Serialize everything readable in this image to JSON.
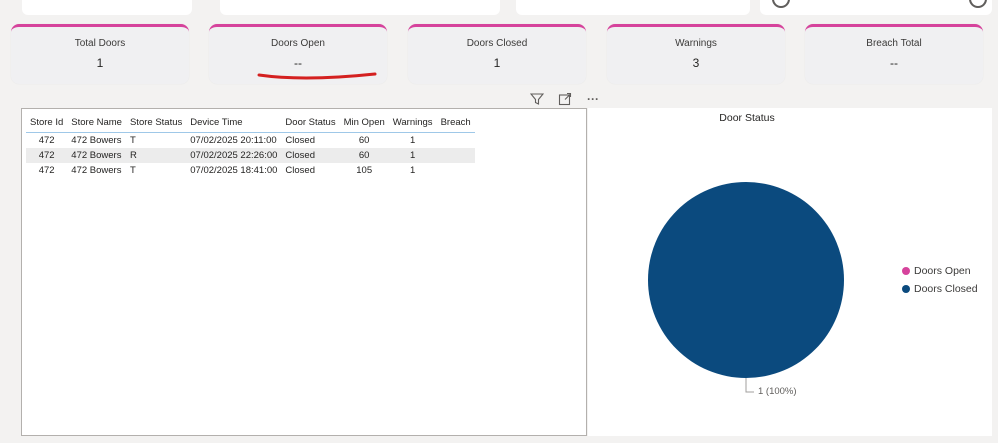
{
  "kpis": [
    {
      "label": "Total Doors",
      "value": "1"
    },
    {
      "label": "Doors Open",
      "value": "--"
    },
    {
      "label": "Doors Closed",
      "value": "1"
    },
    {
      "label": "Warnings",
      "value": "3"
    },
    {
      "label": "Breach Total",
      "value": "--"
    }
  ],
  "table": {
    "headers": [
      "Store Id",
      "Store Name",
      "Store Status",
      "Device Time",
      "Door Status",
      "Min Open",
      "Warnings",
      "Breach"
    ],
    "rows": [
      [
        "472",
        "472 Bowers",
        "T",
        "07/02/2025 20:11:00",
        "Closed",
        "60",
        "1",
        ""
      ],
      [
        "472",
        "472 Bowers",
        "R",
        "07/02/2025 22:26:00",
        "Closed",
        "60",
        "1",
        ""
      ],
      [
        "472",
        "472 Bowers",
        "T",
        "07/02/2025 18:41:00",
        "Closed",
        "105",
        "1",
        ""
      ]
    ]
  },
  "toolbar": {
    "filter_icon": "filter-icon",
    "focus_icon": "focus-mode-icon",
    "more_icon": "more-options-icon",
    "more_glyph": "···"
  },
  "colors": {
    "accent": "#d6439c",
    "doors_closed": "#0b4a7e",
    "doors_open": "#d6439c",
    "annotation": "#d42020"
  },
  "chart_data": {
    "type": "pie",
    "title": "Door Status",
    "slices": [
      {
        "name": "Doors Open",
        "value": 0,
        "color": "#d6439c"
      },
      {
        "name": "Doors Closed",
        "value": 1,
        "color": "#0b4a7e"
      }
    ],
    "data_label": "1 (100%)",
    "legend_position": "right"
  }
}
